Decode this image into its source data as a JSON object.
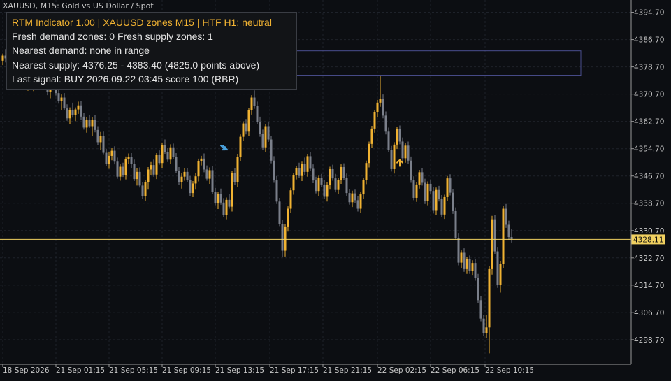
{
  "header": {
    "symbol_title": "XAUUSD, M15:  Gold vs US Dollar / Spot"
  },
  "panel": {
    "title": "RTM Indicator 1.00  |  XAUUSD  zones M15  |  HTF H1: neutral",
    "lines": [
      "Fresh demand zones: 0   Fresh supply zones: 1",
      "Nearest demand: none in range",
      "Nearest supply: 4376.25 - 4383.40  (4825.0 points above)",
      "Last signal: BUY 2026.09.22 03:45  score 100  (RBR)"
    ]
  },
  "colors": {
    "background": "#0c0e12",
    "bull": "#f0b232",
    "bear": "#7a7f8a",
    "price_line": "#f0d060",
    "zone_border": "#4a4f8f",
    "sell_arrow": "#4aa3df",
    "buy_arrow": "#f0b232"
  },
  "chart_data": {
    "type": "candlestick",
    "ylim": [
      4291.5,
      4398.3
    ],
    "y_ticks": [
      "4394.70",
      "4386.70",
      "4378.70",
      "4370.70",
      "4362.70",
      "4354.70",
      "4346.70",
      "4338.70",
      "4330.70",
      "4322.70",
      "4314.70",
      "4306.70",
      "4298.70"
    ],
    "x_ticks": [
      "18 Sep 2026",
      "21 Sep 01:15",
      "21 Sep 05:15",
      "21 Sep 09:15",
      "21 Sep 13:15",
      "21 Sep 17:15",
      "21 Sep 21:15",
      "22 Sep 02:15",
      "22 Sep 06:15",
      "22 Sep 10:15"
    ],
    "current_price": 4328.11,
    "current_price_label": "4328.11",
    "supply_zone": {
      "low": 4376.25,
      "high": 4383.4
    },
    "signals": [
      {
        "type": "sell",
        "bar": 79,
        "price": 4354.0
      },
      {
        "type": "buy",
        "bar": 142,
        "price": 4350.2
      }
    ],
    "candles": [
      [
        4380.5,
        4382.6,
        4379.2,
        4382.0
      ],
      [
        4382.0,
        4383.9,
        4380.0,
        4381.2
      ],
      [
        4381.2,
        4383.5,
        4379.1,
        4380.1
      ],
      [
        4380.1,
        4381.2,
        4377.5,
        4378.3
      ],
      [
        4378.3,
        4380.8,
        4376.2,
        4379.8
      ],
      [
        4379.8,
        4381.0,
        4376.8,
        4377.1
      ],
      [
        4377.1,
        4378.2,
        4373.3,
        4374.0
      ],
      [
        4374.0,
        4376.9,
        4372.1,
        4376.0
      ],
      [
        4376.0,
        4377.6,
        4372.4,
        4373.0
      ],
      [
        4373.0,
        4376.3,
        4371.7,
        4375.3
      ],
      [
        4375.3,
        4377.2,
        4372.5,
        4373.1
      ],
      [
        4373.1,
        4376.8,
        4371.6,
        4376.1
      ],
      [
        4376.1,
        4378.0,
        4373.9,
        4374.6
      ],
      [
        4374.6,
        4377.5,
        4372.3,
        4376.3
      ],
      [
        4376.3,
        4378.6,
        4375.2,
        4377.7
      ],
      [
        4377.7,
        4378.9,
        4373.8,
        4374.6
      ],
      [
        4374.6,
        4375.7,
        4370.4,
        4371.3
      ],
      [
        4371.3,
        4374.9,
        4369.5,
        4374.0
      ],
      [
        4374.0,
        4375.7,
        4372.6,
        4373.1
      ],
      [
        4373.1,
        4374.4,
        4370.3,
        4371.0
      ],
      [
        4371.0,
        4372.2,
        4367.9,
        4368.6
      ],
      [
        4368.6,
        4370.6,
        4366.1,
        4369.7
      ],
      [
        4369.7,
        4371.0,
        4365.9,
        4366.5
      ],
      [
        4366.5,
        4367.7,
        4362.9,
        4363.6
      ],
      [
        4363.6,
        4366.8,
        4361.9,
        4366.1
      ],
      [
        4366.1,
        4368.2,
        4363.8,
        4364.6
      ],
      [
        4364.6,
        4366.8,
        4362.8,
        4366.2
      ],
      [
        4366.2,
        4368.5,
        4364.9,
        4367.4
      ],
      [
        4367.4,
        4368.6,
        4363.2,
        4364.1
      ],
      [
        4364.1,
        4365.2,
        4360.3,
        4360.9
      ],
      [
        4360.9,
        4364.0,
        4359.4,
        4363.2
      ],
      [
        4363.2,
        4364.6,
        4360.8,
        4361.3
      ],
      [
        4361.3,
        4363.9,
        4358.5,
        4363.1
      ],
      [
        4363.1,
        4364.5,
        4359.5,
        4360.2
      ],
      [
        4360.2,
        4361.3,
        4355.8,
        4356.6
      ],
      [
        4356.6,
        4359.6,
        4354.3,
        4358.5
      ],
      [
        4358.5,
        4359.7,
        4352.9,
        4353.5
      ],
      [
        4353.5,
        4354.6,
        4349.7,
        4350.3
      ],
      [
        4350.3,
        4353.6,
        4348.8,
        4352.6
      ],
      [
        4352.6,
        4355.0,
        4351.3,
        4354.1
      ],
      [
        4354.1,
        4355.4,
        4350.1,
        4350.9
      ],
      [
        4350.9,
        4352.1,
        4345.9,
        4346.5
      ],
      [
        4346.5,
        4350.1,
        4345.3,
        4349.4
      ],
      [
        4349.4,
        4350.6,
        4346.4,
        4347.0
      ],
      [
        4347.0,
        4352.4,
        4345.7,
        4351.7
      ],
      [
        4351.7,
        4353.3,
        4350.2,
        4352.3
      ],
      [
        4352.3,
        4353.4,
        4349.1,
        4350.2
      ],
      [
        4350.2,
        4351.5,
        4345.2,
        4345.8
      ],
      [
        4345.8,
        4348.9,
        4343.9,
        4347.9
      ],
      [
        4347.9,
        4349.2,
        4343.3,
        4343.9
      ],
      [
        4343.9,
        4345.0,
        4339.9,
        4340.8
      ],
      [
        4340.8,
        4345.6,
        4339.4,
        4344.9
      ],
      [
        4344.9,
        4349.3,
        4342.7,
        4348.6
      ],
      [
        4348.6,
        4350.8,
        4346.9,
        4349.9
      ],
      [
        4349.9,
        4351.5,
        4346.5,
        4347.1
      ],
      [
        4347.1,
        4353.4,
        4345.8,
        4352.8
      ],
      [
        4352.8,
        4354.2,
        4350.0,
        4350.5
      ],
      [
        4350.5,
        4356.5,
        4349.1,
        4355.7
      ],
      [
        4355.7,
        4357.4,
        4353.0,
        4353.7
      ],
      [
        4353.7,
        4355.0,
        4350.8,
        4351.5
      ],
      [
        4351.5,
        4356.0,
        4350.2,
        4355.1
      ],
      [
        4355.1,
        4356.2,
        4351.6,
        4352.3
      ],
      [
        4352.3,
        4353.4,
        4347.5,
        4348.2
      ],
      [
        4348.2,
        4349.3,
        4344.1,
        4344.9
      ],
      [
        4344.9,
        4347.6,
        4343.0,
        4346.5
      ],
      [
        4346.5,
        4349.0,
        4345.3,
        4347.9
      ],
      [
        4347.9,
        4349.1,
        4344.8,
        4345.6
      ],
      [
        4345.6,
        4346.7,
        4340.9,
        4341.7
      ],
      [
        4341.7,
        4345.2,
        4340.5,
        4344.5
      ],
      [
        4344.5,
        4347.5,
        4342.7,
        4346.6
      ],
      [
        4346.6,
        4351.8,
        4345.1,
        4351.0
      ],
      [
        4351.0,
        4352.6,
        4349.8,
        4351.8
      ],
      [
        4351.8,
        4353.3,
        4347.8,
        4348.6
      ],
      [
        4348.6,
        4349.8,
        4345.3,
        4345.9
      ],
      [
        4345.9,
        4349.2,
        4344.4,
        4348.4
      ],
      [
        4348.4,
        4349.6,
        4341.3,
        4342.0
      ],
      [
        4342.0,
        4343.2,
        4338.1,
        4338.8
      ],
      [
        4338.8,
        4342.1,
        4337.0,
        4341.5
      ],
      [
        4341.5,
        4343.0,
        4338.3,
        4338.9
      ],
      [
        4338.9,
        4340.2,
        4334.6,
        4335.3
      ],
      [
        4335.3,
        4340.4,
        4334.0,
        4339.7
      ],
      [
        4339.7,
        4341.3,
        4337.1,
        4337.7
      ],
      [
        4337.7,
        4348.2,
        4336.3,
        4347.5
      ],
      [
        4347.5,
        4348.9,
        4344.1,
        4344.8
      ],
      [
        4344.8,
        4353.0,
        4343.5,
        4352.2
      ],
      [
        4352.2,
        4358.9,
        4351.0,
        4358.2
      ],
      [
        4358.2,
        4362.7,
        4357.0,
        4362.1
      ],
      [
        4362.1,
        4363.4,
        4358.9,
        4359.7
      ],
      [
        4359.7,
        4366.6,
        4358.4,
        4366.0
      ],
      [
        4366.0,
        4370.4,
        4364.7,
        4369.7
      ],
      [
        4369.7,
        4371.8,
        4366.4,
        4367.2
      ],
      [
        4367.2,
        4368.5,
        4361.8,
        4362.6
      ],
      [
        4362.6,
        4364.1,
        4358.2,
        4359.0
      ],
      [
        4359.0,
        4360.3,
        4354.4,
        4355.1
      ],
      [
        4355.1,
        4362.0,
        4353.8,
        4361.3
      ],
      [
        4361.3,
        4362.5,
        4356.7,
        4357.4
      ],
      [
        4357.4,
        4358.5,
        4350.4,
        4351.2
      ],
      [
        4351.2,
        4352.5,
        4344.7,
        4345.4
      ],
      [
        4345.4,
        4346.7,
        4338.5,
        4339.2
      ],
      [
        4339.2,
        4340.3,
        4332.0,
        4332.6
      ],
      [
        4332.6,
        4333.8,
        4323.0,
        4324.8
      ],
      [
        4324.8,
        4332.7,
        4323.1,
        4331.9
      ],
      [
        4331.9,
        4337.8,
        4330.4,
        4337.1
      ],
      [
        4337.1,
        4343.2,
        4335.9,
        4342.5
      ],
      [
        4342.5,
        4347.6,
        4341.2,
        4346.9
      ],
      [
        4346.9,
        4349.7,
        4345.7,
        4349.0
      ],
      [
        4349.0,
        4350.6,
        4346.1,
        4346.7
      ],
      [
        4346.7,
        4350.9,
        4345.2,
        4350.3
      ],
      [
        4350.3,
        4352.1,
        4347.0,
        4347.9
      ],
      [
        4347.9,
        4353.2,
        4346.5,
        4352.5
      ],
      [
        4352.5,
        4353.8,
        4348.1,
        4348.8
      ],
      [
        4348.8,
        4350.1,
        4344.6,
        4345.4
      ],
      [
        4345.4,
        4346.5,
        4341.6,
        4342.3
      ],
      [
        4342.3,
        4346.8,
        4340.9,
        4346.1
      ],
      [
        4346.1,
        4347.3,
        4343.4,
        4344.2
      ],
      [
        4344.2,
        4345.5,
        4339.9,
        4340.6
      ],
      [
        4340.6,
        4344.8,
        4339.2,
        4344.1
      ],
      [
        4344.1,
        4349.4,
        4342.7,
        4348.7
      ],
      [
        4348.7,
        4350.0,
        4345.3,
        4346.0
      ],
      [
        4346.0,
        4347.3,
        4341.9,
        4342.6
      ],
      [
        4342.6,
        4346.2,
        4341.3,
        4345.5
      ],
      [
        4345.5,
        4350.1,
        4344.4,
        4349.3
      ],
      [
        4349.3,
        4350.4,
        4345.4,
        4346.2
      ],
      [
        4346.2,
        4347.4,
        4340.9,
        4341.7
      ],
      [
        4341.7,
        4342.8,
        4338.3,
        4339.0
      ],
      [
        4339.0,
        4342.4,
        4337.6,
        4341.6
      ],
      [
        4341.6,
        4342.7,
        4338.8,
        4339.6
      ],
      [
        4339.6,
        4340.7,
        4336.3,
        4337.1
      ],
      [
        4337.1,
        4342.0,
        4335.9,
        4341.3
      ],
      [
        4341.3,
        4346.1,
        4340.0,
        4345.5
      ],
      [
        4345.5,
        4351.2,
        4344.3,
        4350.5
      ],
      [
        4350.5,
        4356.8,
        4349.2,
        4356.1
      ],
      [
        4356.1,
        4361.4,
        4354.9,
        4360.6
      ],
      [
        4360.6,
        4366.1,
        4359.4,
        4365.5
      ],
      [
        4365.5,
        4369.0,
        4364.0,
        4368.2
      ],
      [
        4368.2,
        4376.0,
        4367.0,
        4369.3
      ],
      [
        4369.3,
        4370.6,
        4363.6,
        4364.4
      ],
      [
        4364.4,
        4365.6,
        4358.9,
        4359.7
      ],
      [
        4359.7,
        4360.9,
        4353.6,
        4354.3
      ],
      [
        4354.3,
        4355.5,
        4348.0,
        4348.7
      ],
      [
        4348.7,
        4356.6,
        4347.4,
        4355.9
      ],
      [
        4355.9,
        4361.1,
        4354.6,
        4360.4
      ],
      [
        4360.4,
        4361.5,
        4356.0,
        4356.8
      ],
      [
        4356.8,
        4358.0,
        4351.1,
        4351.9
      ],
      [
        4351.9,
        4356.4,
        4350.6,
        4355.6
      ],
      [
        4355.6,
        4356.8,
        4350.3,
        4351.2
      ],
      [
        4351.2,
        4352.4,
        4344.7,
        4345.4
      ],
      [
        4345.4,
        4346.6,
        4339.6,
        4340.3
      ],
      [
        4340.3,
        4344.9,
        4339.1,
        4344.2
      ],
      [
        4344.2,
        4348.5,
        4343.0,
        4347.8
      ],
      [
        4347.8,
        4349.0,
        4343.9,
        4344.7
      ],
      [
        4344.7,
        4345.9,
        4338.5,
        4339.3
      ],
      [
        4339.3,
        4345.1,
        4338.1,
        4344.4
      ],
      [
        4344.4,
        4345.7,
        4341.5,
        4342.3
      ],
      [
        4342.3,
        4343.4,
        4335.7,
        4336.5
      ],
      [
        4336.5,
        4343.3,
        4335.3,
        4342.6
      ],
      [
        4342.6,
        4343.8,
        4339.2,
        4340.0
      ],
      [
        4340.0,
        4341.1,
        4334.6,
        4335.4
      ],
      [
        4335.4,
        4341.2,
        4334.1,
        4340.5
      ],
      [
        4340.5,
        4346.7,
        4339.3,
        4346.0
      ],
      [
        4346.0,
        4347.2,
        4341.0,
        4341.8
      ],
      [
        4341.8,
        4342.9,
        4335.6,
        4336.4
      ],
      [
        4336.4,
        4337.5,
        4327.8,
        4328.6
      ],
      [
        4328.6,
        4329.8,
        4320.5,
        4321.3
      ],
      [
        4321.3,
        4324.9,
        4319.7,
        4324.2
      ],
      [
        4324.2,
        4325.5,
        4318.6,
        4319.4
      ],
      [
        4319.4,
        4323.0,
        4318.0,
        4322.3
      ],
      [
        4322.3,
        4323.4,
        4318.0,
        4318.8
      ],
      [
        4318.8,
        4322.0,
        4317.5,
        4321.2
      ],
      [
        4321.2,
        4322.4,
        4316.0,
        4316.8
      ],
      [
        4316.8,
        4318.0,
        4309.5,
        4310.3
      ],
      [
        4310.3,
        4311.4,
        4304.1,
        4304.9
      ],
      [
        4304.9,
        4306.0,
        4299.8,
        4300.6
      ],
      [
        4300.6,
        4306.0,
        4299.3,
        4302.3
      ],
      [
        4302.3,
        4320.2,
        4294.7,
        4319.4
      ],
      [
        4319.4,
        4335.0,
        4317.8,
        4334.0
      ],
      [
        4334.0,
        4335.2,
        4323.8,
        4324.6
      ],
      [
        4324.6,
        4325.7,
        4313.9,
        4314.7
      ],
      [
        4314.7,
        4321.7,
        4312.5,
        4320.9
      ],
      [
        4320.9,
        4337.9,
        4319.6,
        4337.1
      ],
      [
        4337.1,
        4338.5,
        4331.5,
        4332.4
      ],
      [
        4332.4,
        4333.6,
        4328.0,
        4328.8
      ],
      [
        4328.8,
        4331.2,
        4327.2,
        4328.1
      ]
    ]
  }
}
